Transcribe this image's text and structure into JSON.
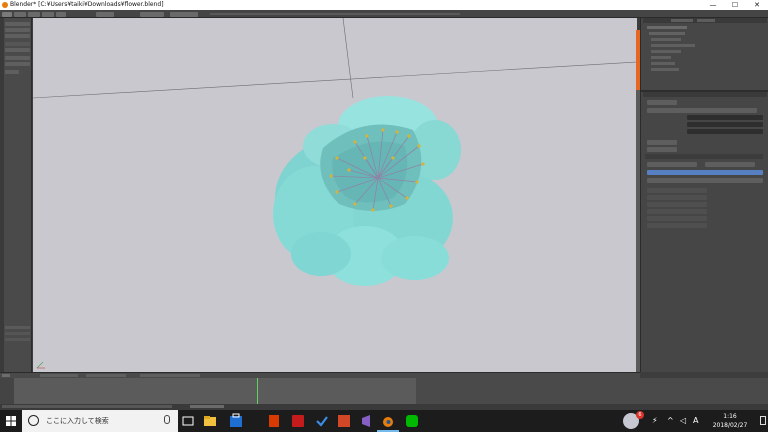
{
  "window": {
    "title": "Blender* [C:¥Users¥taiki¥Downloads¥flower.blend]",
    "minimize": "—",
    "maximize": "☐",
    "close": "✕"
  },
  "taskbar": {
    "search_placeholder": "ここに入力して検索",
    "time": "1:16",
    "date": "2018/02/27",
    "ime_indicator": "A",
    "notification_count": "6"
  },
  "colors": {
    "viewport_bg": "#c9c8cf",
    "petal": "#8fdcd8",
    "stamen_tip": "#d4b43a",
    "accent_orange": "#e6671f",
    "timeline_cursor": "#5fd35f"
  },
  "icons": [
    "blender-icon",
    "windows-start-icon",
    "search-icon",
    "mic-icon",
    "task-view-icon",
    "explorer-icon",
    "store-icon",
    "office-icon",
    "powerpoint-icon",
    "visual-studio-icon",
    "blender-taskbar-icon",
    "line-icon",
    "notification-icon"
  ]
}
